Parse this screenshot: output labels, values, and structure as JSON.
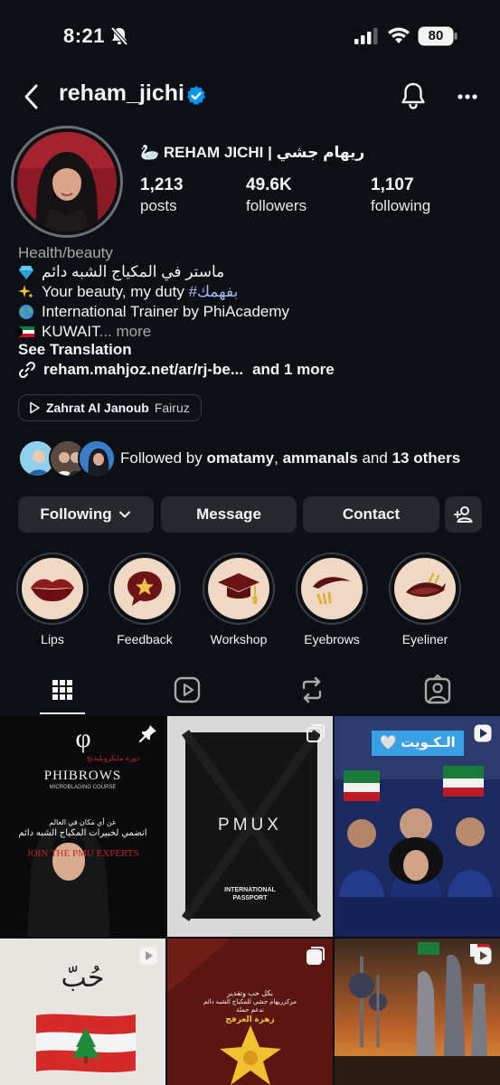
{
  "status_bar": {
    "time": "8:21",
    "battery": "80"
  },
  "header": {
    "username": "reham_jichi"
  },
  "profile": {
    "display_name": "🦢 REHAM JICHI | ريهام جشي",
    "stats": [
      {
        "value": "1,213",
        "label": "posts"
      },
      {
        "value": "49.6K",
        "label": "followers"
      },
      {
        "value": "1,107",
        "label": "following"
      }
    ],
    "category": "Health/beauty",
    "bio": {
      "line1": "ماستر في المكياج الشبه دائم",
      "line2_text": "Your beauty, my duty",
      "line2_hashtag": "#بفهمك",
      "line3": "International Trainer by PhiAcademy",
      "line4": "KUWAIT",
      "line4_ellipsis": "...",
      "more": "more"
    },
    "see_translation": "See Translation",
    "link": {
      "url": "reham.mahjoz.net/ar/rj-be...",
      "extra": "and 1 more"
    },
    "music": {
      "song": "Zahrat Al Janoub",
      "artist": "Fairuz"
    }
  },
  "followed_by": {
    "prefix": "Followed by",
    "user1": "omatamy",
    "sep": ",",
    "user2": "ammanals",
    "and": "and",
    "others": "13 others"
  },
  "actions": {
    "following": "Following",
    "message": "Message",
    "contact": "Contact"
  },
  "highlights": [
    {
      "label": "Lips",
      "icon": "lips-icon"
    },
    {
      "label": "Feedback",
      "icon": "star-bubble-icon"
    },
    {
      "label": "Workshop",
      "icon": "graduation-cap-icon"
    },
    {
      "label": "Eyebrows",
      "icon": "eyebrow-icon"
    },
    {
      "label": "Eyeliner",
      "icon": "eyeliner-icon"
    }
  ],
  "posts": {
    "p1": {
      "brand": "PHIBROWS",
      "sub": "MICROBLADING COURSE",
      "ar_small": "دورة مايكروبليدنج",
      "ar_line1": "عن أي مكان في العالم",
      "ar_line2": "انضمي لخبيرات المكياج الشبه دائم",
      "cta": "JOIN THE PMU EXPERTS"
    },
    "p2": {
      "title": "PMUX",
      "line1": "INTERNATIONAL",
      "line2": "PASSPORT"
    },
    "p3": {
      "caption": "🤍 الـكـويت"
    },
    "p4": {
      "word": "حُبّ"
    },
    "p5": {
      "line1": "بكل حب وتقدير",
      "line2": "مركزريهام جشي للمكياج الشبه دائم",
      "line3": "ندعم حملة",
      "line4": "زهرة العرفج"
    }
  },
  "colors": {
    "accent_blue": "#0095f6",
    "hashtag": "#a5b7f5",
    "button_bg": "#25292e",
    "background": "#0c1014"
  }
}
